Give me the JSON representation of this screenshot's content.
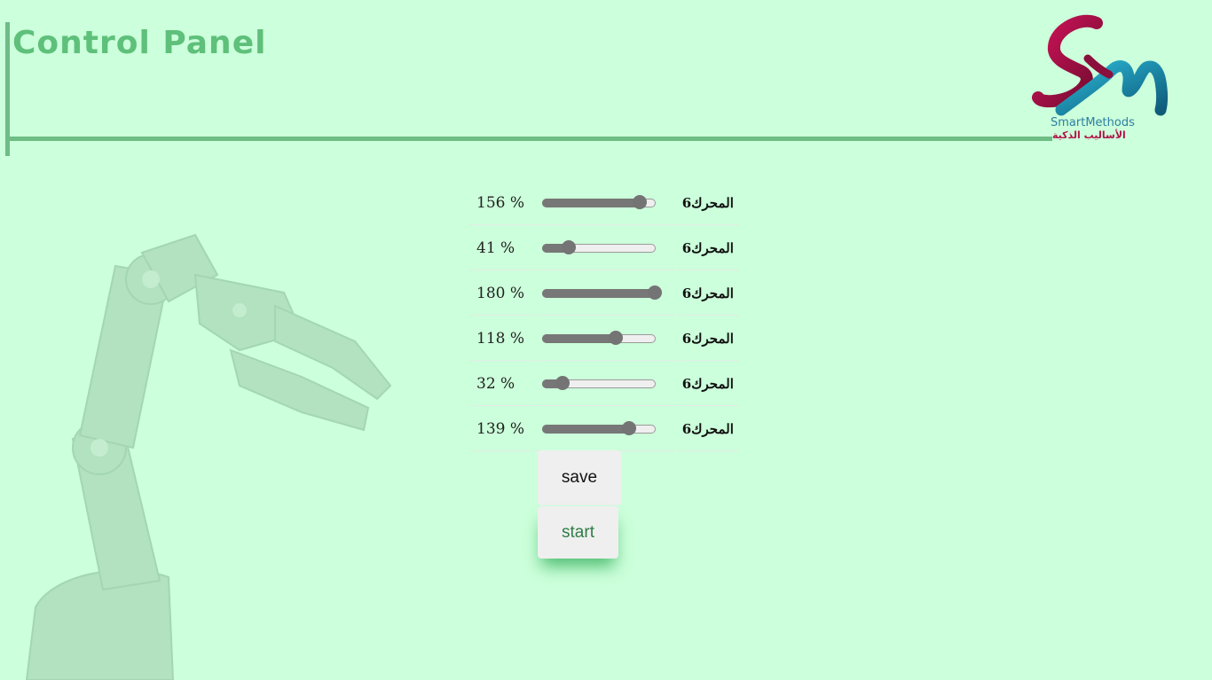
{
  "header": {
    "title": "Control Panel"
  },
  "logo": {
    "text_en": "SmartMethods",
    "text_ar": "الأساليب الذكية"
  },
  "motors": [
    {
      "label": "المحرك6",
      "value_text": "156 %",
      "value": 156
    },
    {
      "label": "المحرك6",
      "value_text": "41 %",
      "value": 41
    },
    {
      "label": "المحرك6",
      "value_text": "180 %",
      "value": 180
    },
    {
      "label": "المحرك6",
      "value_text": "118 %",
      "value": 118
    },
    {
      "label": "المحرك6",
      "value_text": "32 %",
      "value": 32
    },
    {
      "label": "المحرك6",
      "value_text": "139 %",
      "value": 139
    }
  ],
  "slider_range": {
    "min": 0,
    "max": 180
  },
  "buttons": {
    "save_label": "save",
    "start_label": "start"
  },
  "colors": {
    "background": "#ccffdb",
    "accent": "#6dbd85",
    "title": "#5ec07a",
    "start_text": "#2e7d45",
    "start_shadow": "#28aa50"
  },
  "icons": {
    "logo": "smart-methods-logo",
    "background_image": "robot-arm-icon"
  }
}
